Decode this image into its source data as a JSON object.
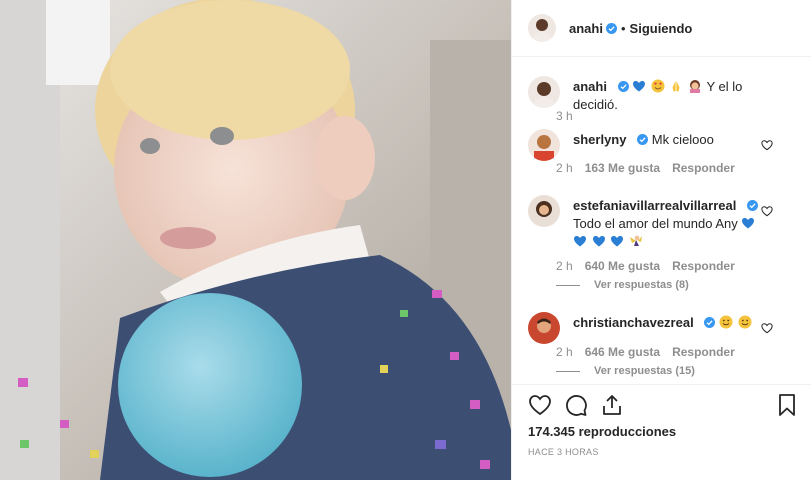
{
  "header": {
    "username": "anahi",
    "separator": "•",
    "follow_label": "Siguiendo"
  },
  "caption": {
    "username": "anahi",
    "text": "Y el lo decidió.",
    "time": "3 h"
  },
  "comments": [
    {
      "username": "sherlyny",
      "text": "Mk cielooo",
      "time": "2 h",
      "likes": "163 Me gusta",
      "reply": "Responder"
    },
    {
      "username": "estefaniavillarrealvillarreal",
      "text": "Todo el amor del mundo Any",
      "time": "2 h",
      "likes": "640 Me gusta",
      "reply": "Responder",
      "replies": "Ver respuestas (8)"
    },
    {
      "username": "christianchavezreal",
      "text": "",
      "time": "2 h",
      "likes": "646 Me gusta",
      "reply": "Responder",
      "replies": "Ver respuestas (15)"
    }
  ],
  "footer": {
    "views": "174.345 reproducciones",
    "posted": "HACE 3 HORAS"
  },
  "colors": {
    "verified": "#3897f0",
    "heart_blue": "#2a7fd4",
    "text": "#262626",
    "muted": "#8e8e8e"
  },
  "icons": [
    "verified-icon",
    "heart-icon",
    "comment-icon",
    "share-icon",
    "bookmark-icon"
  ]
}
